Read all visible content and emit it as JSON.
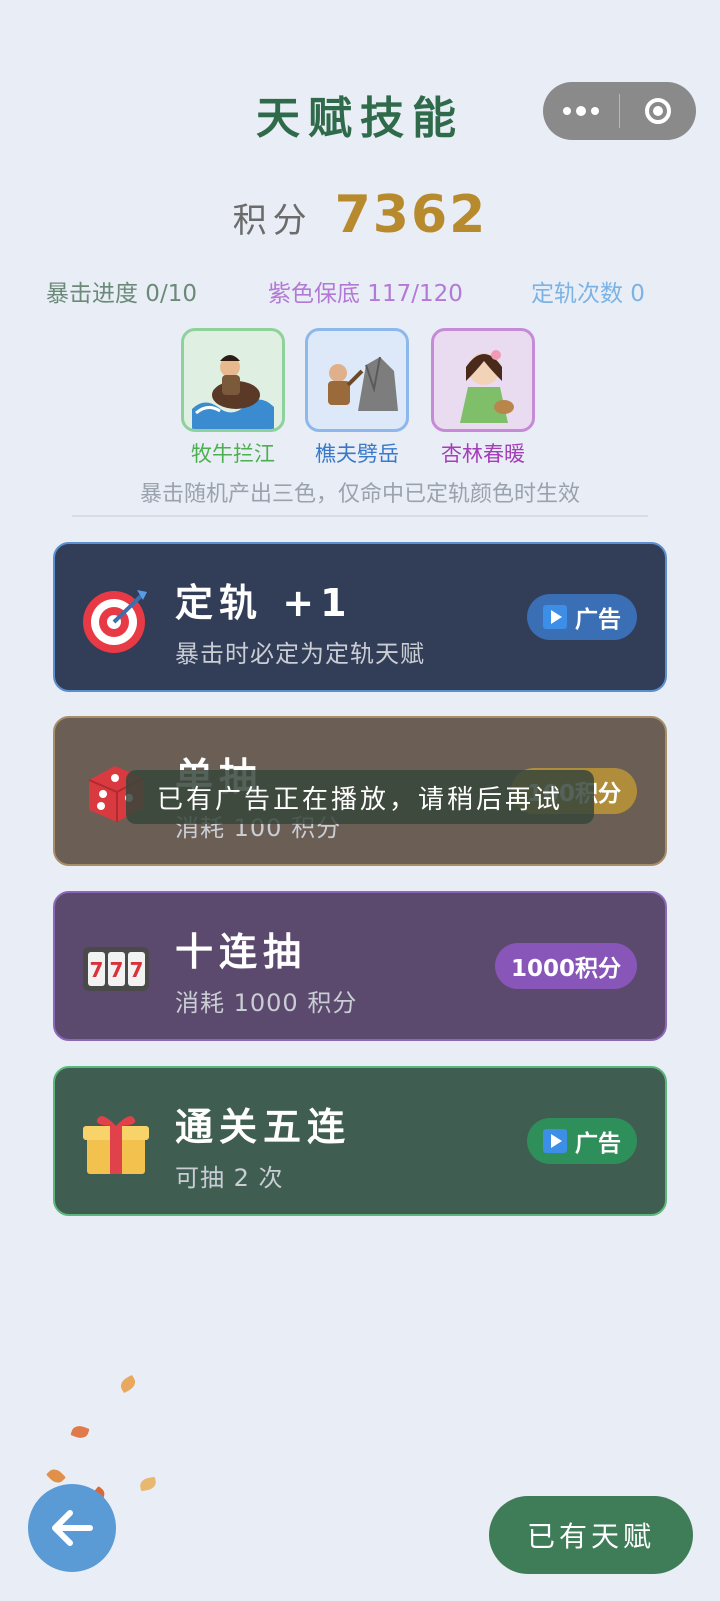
{
  "header": {
    "title": "天赋技能"
  },
  "score": {
    "label": "积分",
    "value": "7362"
  },
  "stats": {
    "crit": "暴击进度 0/10",
    "purple": "紫色保底 117/120",
    "track": "定轨次数 0"
  },
  "characters": [
    {
      "name": "牧牛拦江",
      "color": "#4caf50",
      "border": "#8fd19a",
      "bg": "#dff0e2"
    },
    {
      "name": "樵夫劈岳",
      "color": "#3a78c9",
      "border": "#8db8ec",
      "bg": "#dde9f8"
    },
    {
      "name": "杏林春暖",
      "color": "#a33fb8",
      "border": "#c78ad6",
      "bg": "#eadcf0"
    }
  ],
  "hint": "暴击随机产出三色，仅命中已定轨颜色时生效",
  "options": [
    {
      "title": "定轨 +1",
      "subtitle": "暴击时必定为定轨天赋",
      "badge": "广告",
      "icon": "target-icon"
    },
    {
      "title": "单抽",
      "subtitle": "消耗 100 积分",
      "badge": "100积分",
      "icon": "dice-icon"
    },
    {
      "title": "十连抽",
      "subtitle": "消耗 1000 积分",
      "badge": "1000积分",
      "icon": "slot-machine-icon"
    },
    {
      "title": "通关五连",
      "subtitle": "可抽 2 次",
      "badge": "广告",
      "icon": "gift-icon"
    }
  ],
  "toast": "已有广告正在播放，请稍后再试",
  "footer": {
    "owned_label": "已有天赋"
  },
  "colors": {
    "title_green": "#2f6b4a",
    "score_gold": "#b88a2e",
    "card_navy": "#323d57",
    "card_brown": "#6b5e55",
    "card_purple": "#5c4a6e",
    "card_green": "#3f5e51"
  }
}
